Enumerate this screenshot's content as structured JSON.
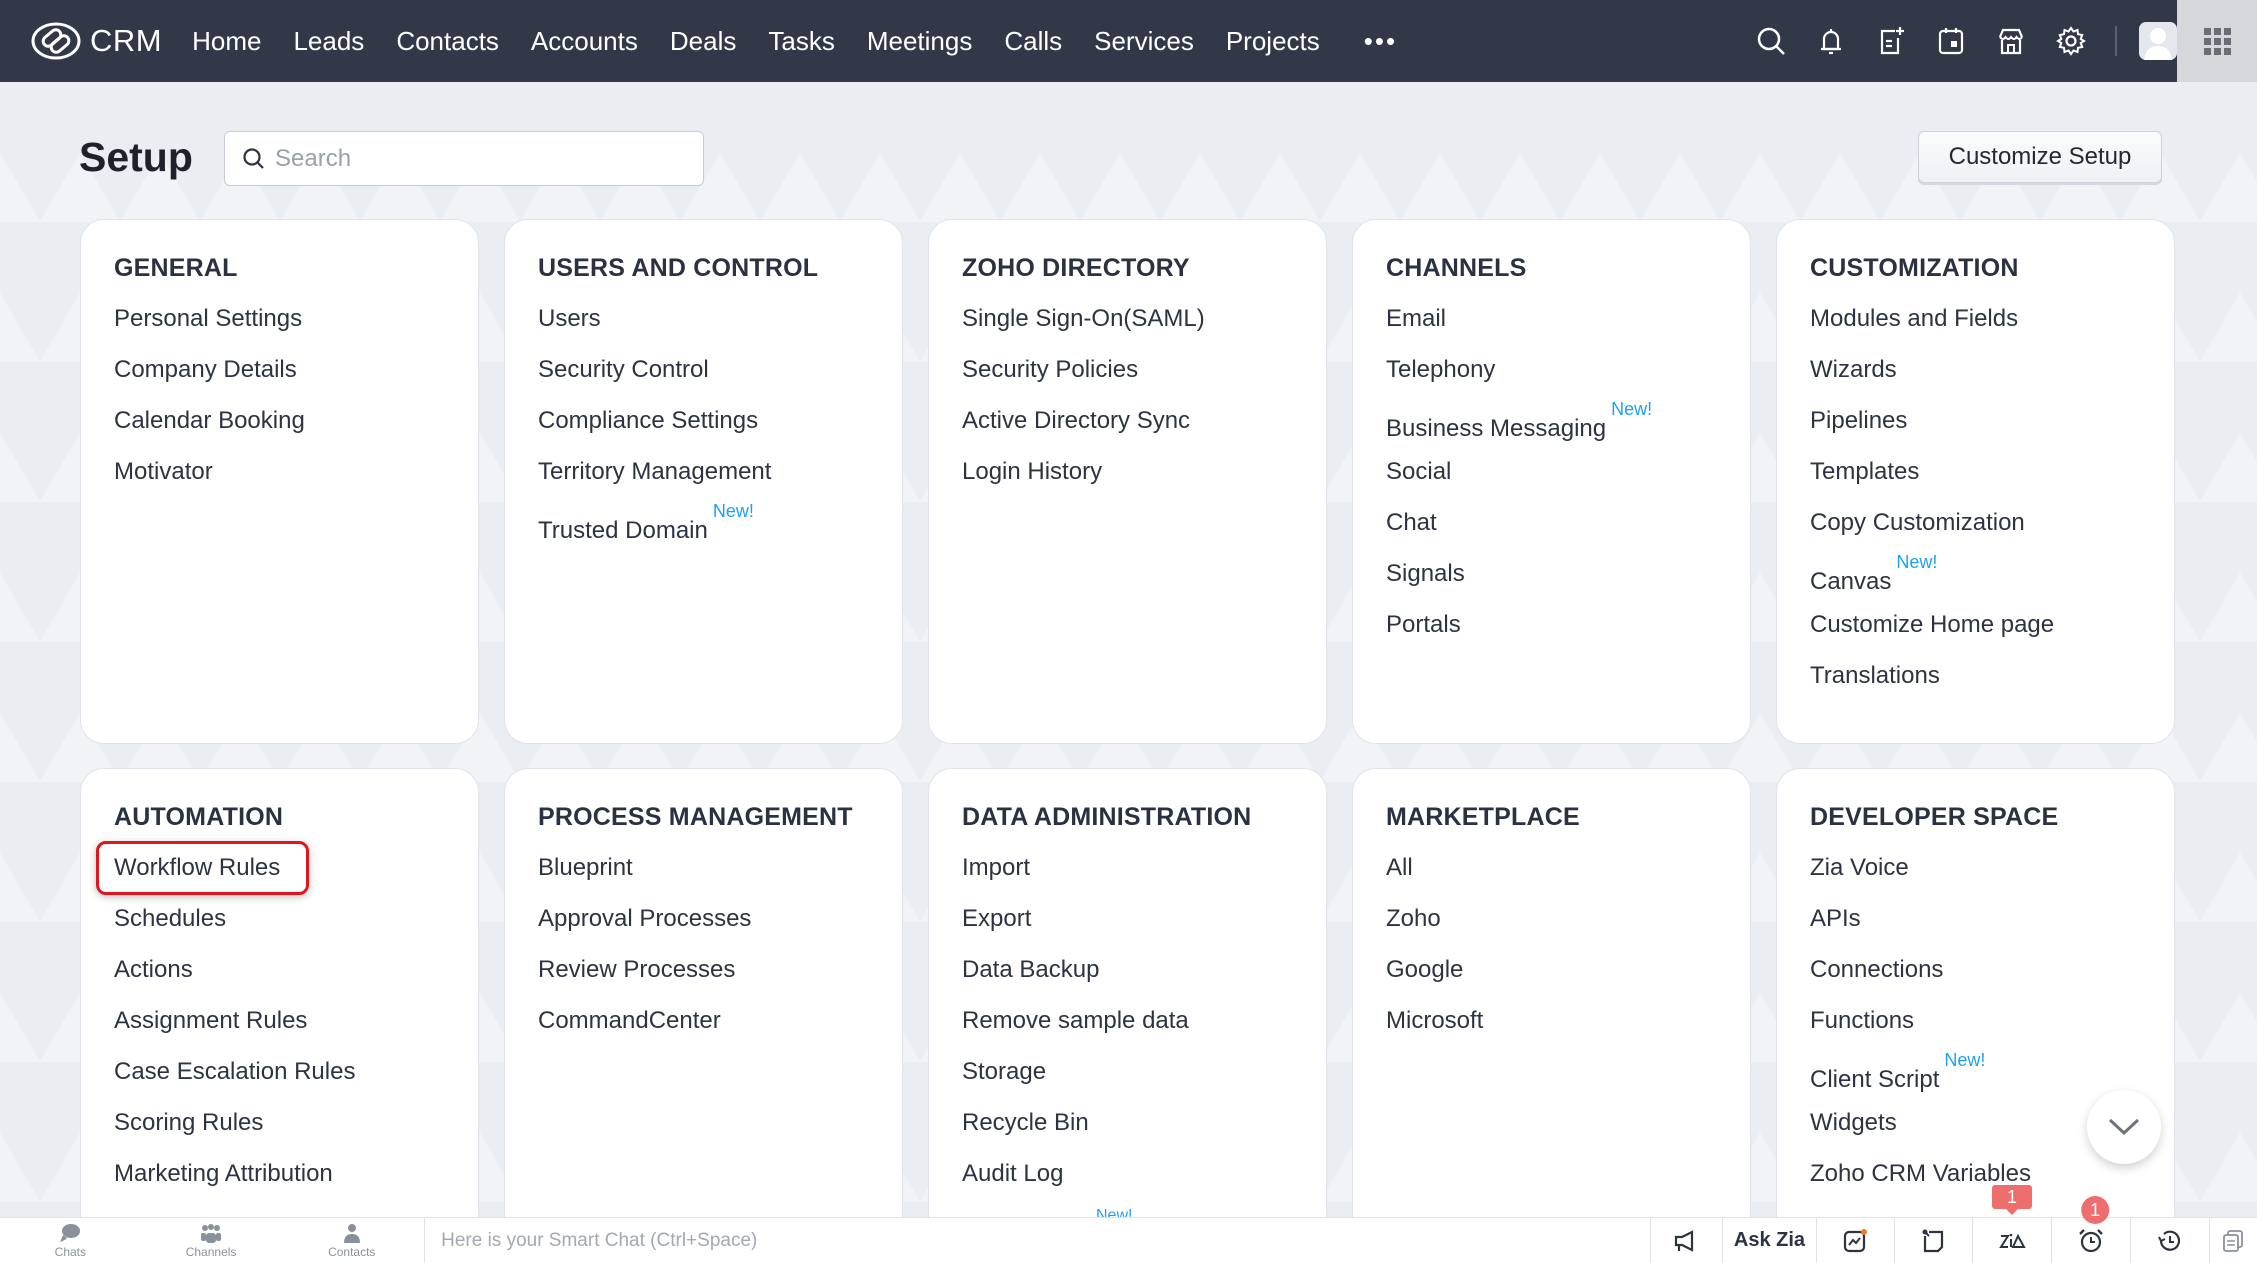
{
  "topnav": {
    "app_name": "CRM",
    "items": [
      "Home",
      "Leads",
      "Contacts",
      "Accounts",
      "Deals",
      "Tasks",
      "Meetings",
      "Calls",
      "Services",
      "Projects"
    ],
    "more_label": "•••",
    "icons": [
      "search-icon",
      "bell-icon",
      "add-note-icon",
      "calendar-icon",
      "marketplace-store-icon",
      "gear-icon"
    ]
  },
  "setup": {
    "title": "Setup",
    "search_placeholder": "Search",
    "customize_label": "Customize Setup"
  },
  "new_badge": "New!",
  "sections": [
    {
      "title": "GENERAL",
      "items": [
        {
          "label": "Personal Settings"
        },
        {
          "label": "Company Details"
        },
        {
          "label": "Calendar Booking"
        },
        {
          "label": "Motivator"
        }
      ]
    },
    {
      "title": "USERS AND CONTROL",
      "items": [
        {
          "label": "Users"
        },
        {
          "label": "Security Control"
        },
        {
          "label": "Compliance Settings"
        },
        {
          "label": "Territory Management"
        },
        {
          "label": "Trusted Domain",
          "new": true
        }
      ]
    },
    {
      "title": "ZOHO DIRECTORY",
      "items": [
        {
          "label": "Single Sign-On(SAML)"
        },
        {
          "label": "Security Policies"
        },
        {
          "label": "Active Directory Sync"
        },
        {
          "label": "Login History"
        }
      ]
    },
    {
      "title": "CHANNELS",
      "items": [
        {
          "label": "Email"
        },
        {
          "label": "Telephony"
        },
        {
          "label": "Business Messaging",
          "new": true
        },
        {
          "label": "Social"
        },
        {
          "label": "Chat"
        },
        {
          "label": "Signals"
        },
        {
          "label": "Portals"
        }
      ]
    },
    {
      "title": "CUSTOMIZATION",
      "items": [
        {
          "label": "Modules and Fields"
        },
        {
          "label": "Wizards"
        },
        {
          "label": "Pipelines"
        },
        {
          "label": "Templates"
        },
        {
          "label": "Copy Customization"
        },
        {
          "label": "Canvas",
          "new": true
        },
        {
          "label": "Customize Home page"
        },
        {
          "label": "Translations"
        }
      ]
    },
    {
      "title": "AUTOMATION",
      "items": [
        {
          "label": "Workflow Rules",
          "highlighted": true
        },
        {
          "label": "Schedules"
        },
        {
          "label": "Actions"
        },
        {
          "label": "Assignment Rules"
        },
        {
          "label": "Case Escalation Rules"
        },
        {
          "label": "Scoring Rules"
        },
        {
          "label": "Marketing Attribution"
        }
      ]
    },
    {
      "title": "PROCESS MANAGEMENT",
      "items": [
        {
          "label": "Blueprint"
        },
        {
          "label": "Approval Processes"
        },
        {
          "label": "Review Processes"
        },
        {
          "label": "CommandCenter"
        }
      ]
    },
    {
      "title": "DATA ADMINISTRATION",
      "items": [
        {
          "label": "Import"
        },
        {
          "label": "Export"
        },
        {
          "label": "Data Backup"
        },
        {
          "label": "Remove sample data"
        },
        {
          "label": "Storage"
        },
        {
          "label": "Recycle Bin"
        },
        {
          "label": "Audit Log"
        }
      ]
    },
    {
      "title": "MARKETPLACE",
      "items": [
        {
          "label": "All"
        },
        {
          "label": "Zoho"
        },
        {
          "label": "Google"
        },
        {
          "label": "Microsoft"
        }
      ]
    },
    {
      "title": "DEVELOPER SPACE",
      "items": [
        {
          "label": "Zia Voice"
        },
        {
          "label": "APIs"
        },
        {
          "label": "Connections"
        },
        {
          "label": "Functions"
        },
        {
          "label": "Client Script",
          "new": true
        },
        {
          "label": "Widgets"
        },
        {
          "label": "Zoho CRM Variables"
        }
      ]
    }
  ],
  "footer": {
    "tabs": [
      {
        "label": "Chats",
        "icon": "chat-bubbles-icon"
      },
      {
        "label": "Channels",
        "icon": "channels-group-icon"
      },
      {
        "label": "Contacts",
        "icon": "contact-person-icon"
      }
    ],
    "smart_chat_placeholder": "Here is your Smart Chat (Ctrl+Space)",
    "ask_zia_label": "Ask Zia",
    "zia_badge": "1",
    "alarm_badge": "1"
  },
  "colors": {
    "header_bg": "#323848",
    "new_badge": "#1ea1f2",
    "highlight": "#e0151d",
    "notification_badge": "#ee6e6e"
  }
}
